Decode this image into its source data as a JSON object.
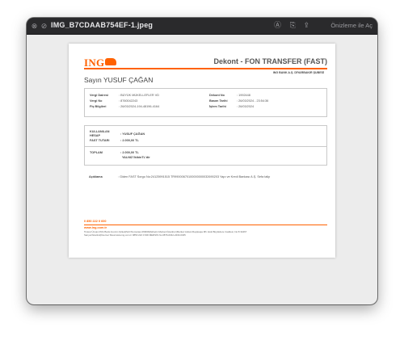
{
  "window": {
    "title": "IMG_B7CDAAB754EF-1.jpeg",
    "open_with_label": "Önizleme ile Aç",
    "icons": [
      "close-icon",
      "fullscreen-icon",
      "markup-icon",
      "rotate-icon",
      "share-icon"
    ]
  },
  "document": {
    "logo_text": "ING",
    "title": "Dekont - FON TRANSFER (FAST)",
    "branch": "ING BANK A.Ş. DİYARBAKIR ŞUBESİ",
    "greeting": "Sayın YUSUF ÇAĞAN",
    "info": {
      "left": [
        {
          "label": "Vergi Dairesi",
          "value": ": BÜYÜK MÜKELLEFLER VD"
        },
        {
          "label": "Vergi No",
          "value": ": 8760042243"
        },
        {
          "label": "Fiş Bilgileri",
          "value": ": 26/03/2024-194-48196-4164"
        }
      ],
      "right": [
        {
          "label": "Dekont No",
          "value": ": 1992448"
        },
        {
          "label": "Basım Tarihi",
          "value": ": 26/03/2024 - 23:54:36"
        },
        {
          "label": "İşlem Tarihi",
          "value": ": 26/03/2024"
        }
      ]
    },
    "amount": {
      "user_label_1": "KULLANILAN",
      "user_label_2": "HESAP",
      "user_value": ": YUSUF ÇAĞAN",
      "fast_label": "FAST TUTARI",
      "fast_value": ": 2.000,00 TL",
      "total_label": "TOPLAM",
      "total_value": ": 2.000,00 TL",
      "total_words": "YALNIZ İkibinTL'dir"
    },
    "description_label": "Açıklama",
    "description_value": ": Giden FAST Sorgu No:24125991515 TR99000670100000000032690203 Yapı ve Kredi Bankası A.Ş. Sefa talip",
    "footer": {
      "phone": "0 850 222 0 600",
      "web": "www.ing.com.tr",
      "line1": "Ticaret Ünvanı:ING Bank Anonim Şirketi|Sicil Numarası:269049|Şirketin Merkezi:İstanbul |Merkez Adresi:Reşitpaşa Mh. Eski Büyükdere Caddesi, No:8 34467",
      "line2": "Sarıyer/İstanbul|İnternet Sitesi:www.ing.com.tr 0850 222 0 600 MERSİS No.0876-0042-2430-0345"
    }
  }
}
